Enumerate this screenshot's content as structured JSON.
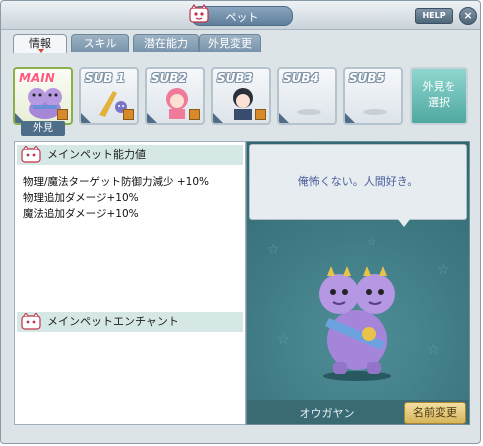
{
  "window": {
    "title": "ペット",
    "help_label": "HELP",
    "close_label": "×"
  },
  "tabs": [
    {
      "label": "情報",
      "active": true
    },
    {
      "label": "スキル",
      "active": false
    },
    {
      "label": "潜在能力",
      "active": false
    },
    {
      "label": "外見変更",
      "active": false
    }
  ],
  "slots": [
    {
      "label": "MAIN",
      "selected": true
    },
    {
      "label": "SUB 1"
    },
    {
      "label": "SUB2"
    },
    {
      "label": "SUB3"
    },
    {
      "label": "SUB4"
    },
    {
      "label": "SUB5"
    }
  ],
  "appearance_tag": "外見",
  "select_appearance_button": {
    "line1": "外見を",
    "line2": "選択"
  },
  "ability_section": {
    "title": "メインペット能力値",
    "stats": [
      "物理/魔法ターゲット防御力減少 +10%",
      "物理追加ダメージ+10%",
      "魔法追加ダメージ+10%"
    ]
  },
  "enchant_section": {
    "title": "メインペットエンチャント"
  },
  "pet": {
    "dialogue": "俺怖くない。人間好き。",
    "name": "オウガヤン",
    "rename_label": "名前変更"
  },
  "colors": {
    "tab_active_bg": "#f4f7f9",
    "main_label": "#ff5a7a",
    "pet_bg": "#2f6670",
    "speech_text": "#4a5d9a"
  }
}
